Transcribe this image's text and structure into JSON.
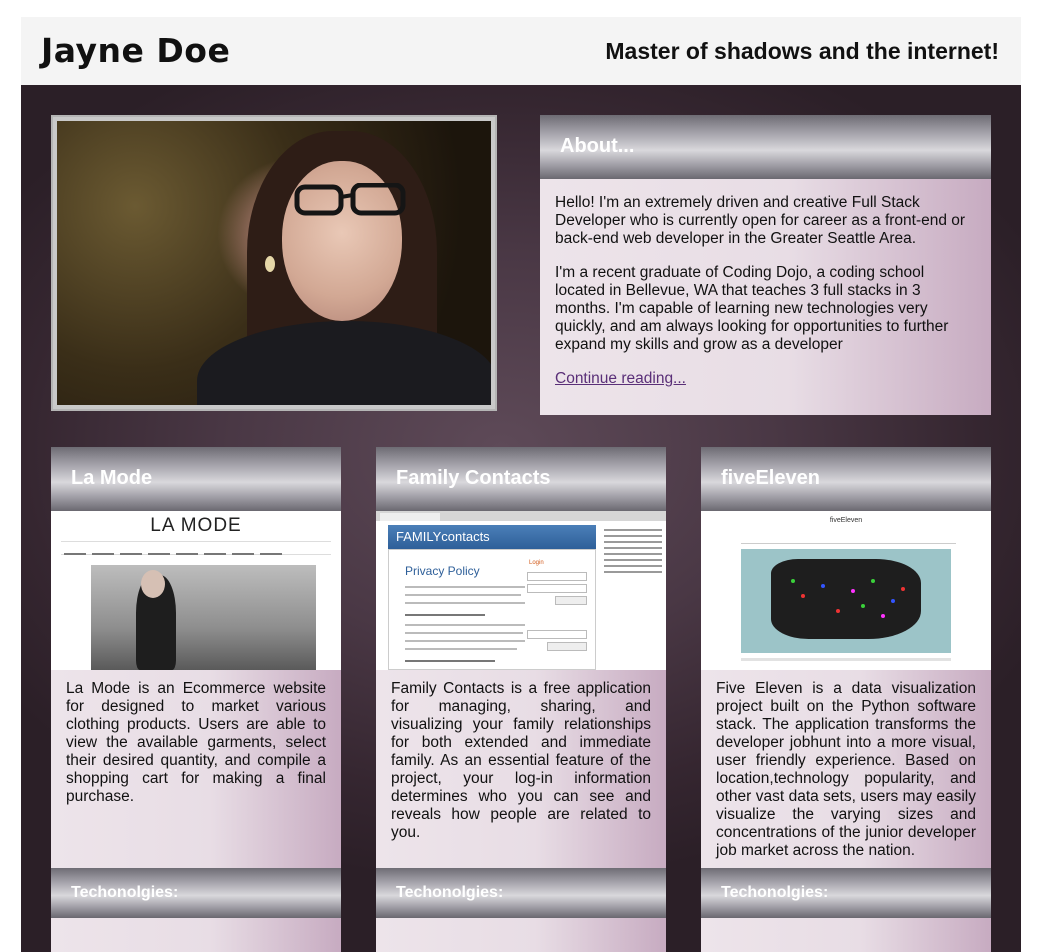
{
  "header": {
    "name": "Jayne Doe",
    "tagline": "Master of shadows and the internet!"
  },
  "about": {
    "title": "About...",
    "paragraphs": [
      "Hello! I'm an extremely driven and creative Full Stack Developer who is currently open for career as a front-end or back-end web developer in the Greater Seattle Area.",
      "I'm a recent graduate of Coding Dojo, a coding school located in Bellevue, WA that teaches 3 full stacks in 3 months. I'm capable of learning new technologies very quickly, and am always looking for opportunities to further expand my skills and grow as a developer"
    ],
    "link": "Continue reading..."
  },
  "projects": [
    {
      "title": "La Mode",
      "screenshot_title": "LA MODE",
      "description": "La Mode is an Ecommerce website for designed to market various clothing products. Users are able to view the available garments, select their desired quantity, and compile a shopping cart for making a final purchase.",
      "tech_title": "Techonolgies:"
    },
    {
      "title": "Family Contacts",
      "screenshot_header": "FAMILYcontacts",
      "screenshot_heading": "Privacy Policy",
      "screenshot_login": "Login",
      "description": "Family Contacts is a free application for managing, sharing, and visualizing your family relationships for both extended and immediate family. As an essential feature of the project, your log-in information determines who you can see and reveals how people are related to you.",
      "tech_title": "Techonolgies:"
    },
    {
      "title": "fiveEleven",
      "screenshot_title": "fiveEleven",
      "description": "Five Eleven is a data visualization project built on the Python software stack. The application transforms the developer jobhunt into a more visual, user friendly experience. Based on location,technology popularity, and other vast data sets, users may easily visualize the varying sizes and concentrations of the junior developer job market across the nation.",
      "tech_title": "Techonolgies:"
    }
  ],
  "colors": {
    "header_bg": "#f4f4f4",
    "main_bg": "#4a3845",
    "card_light": "#ede4ea",
    "card_accent": "#c7abc1",
    "link": "#5a2f78"
  }
}
